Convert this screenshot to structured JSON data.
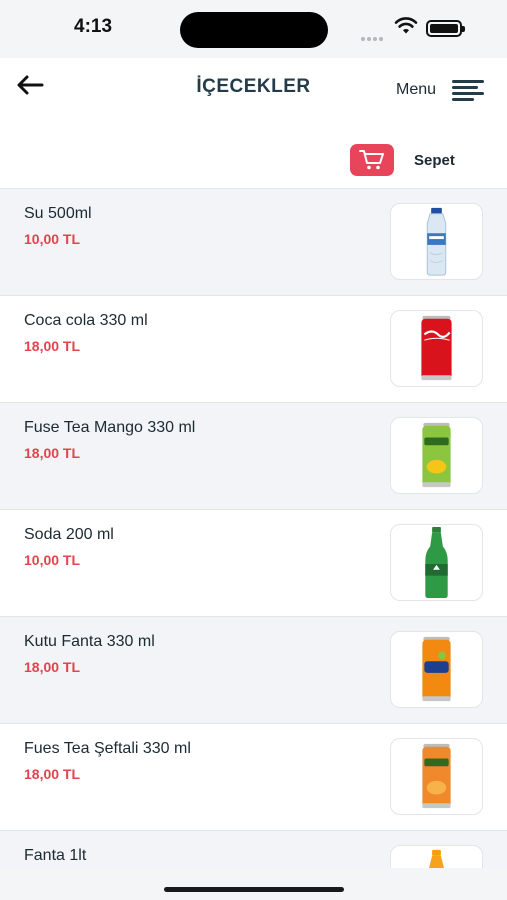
{
  "status_bar": {
    "time": "4:13"
  },
  "header": {
    "title": "İÇECEKLER",
    "menu_label": "Menu"
  },
  "cart": {
    "label": "Sepet"
  },
  "colors": {
    "accent": "#e8455b",
    "price": "#e2434f",
    "row_alt": "#f2f4f7",
    "title": "#243b4a"
  },
  "products": [
    {
      "name": "Su 500ml",
      "price": "10,00 TL",
      "icon": "water-bottle-icon"
    },
    {
      "name": "Coca cola 330 ml",
      "price": "18,00 TL",
      "icon": "cola-can-icon"
    },
    {
      "name": "Fuse Tea Mango 330 ml",
      "price": "18,00 TL",
      "icon": "fuse-tea-mango-can-icon"
    },
    {
      "name": "Soda 200 ml",
      "price": "10,00 TL",
      "icon": "soda-bottle-icon"
    },
    {
      "name": "Kutu Fanta 330 ml",
      "price": "18,00 TL",
      "icon": "fanta-can-icon"
    },
    {
      "name": "Fues Tea Şeftali 330 ml",
      "price": "18,00 TL",
      "icon": "fuse-tea-peach-can-icon"
    },
    {
      "name": "Fanta 1lt",
      "price": "",
      "icon": "fanta-bottle-icon"
    }
  ]
}
